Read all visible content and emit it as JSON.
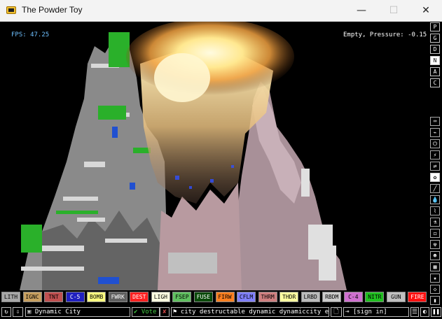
{
  "window": {
    "title": "The Powder Toy",
    "controls": {
      "minimize": "—",
      "maximize": "☐",
      "close": "✕"
    }
  },
  "hud": {
    "fps": "FPS: 47.25",
    "status": "Empty, Pressure: -0.15"
  },
  "right_menu": {
    "top": [
      {
        "label": "P",
        "name": "pause-indicator"
      },
      {
        "label": "G",
        "name": "gravity-indicator"
      },
      {
        "label": "D",
        "name": "decorations-indicator"
      },
      {
        "label": "N",
        "name": "newtonian-indicator",
        "selected": true
      },
      {
        "label": "A",
        "name": "air-indicator"
      },
      {
        "label": "C",
        "name": "colour-indicator"
      }
    ],
    "categories": [
      {
        "icon": "⌨",
        "name": "electronics-icon"
      },
      {
        "icon": "⌁",
        "name": "powered-icon"
      },
      {
        "icon": "⏻",
        "name": "power-icon"
      },
      {
        "icon": "⚡",
        "name": "force-icon"
      },
      {
        "icon": "⇄",
        "name": "sensors-icon"
      },
      {
        "icon": "✿",
        "name": "explosives-icon",
        "selected": true
      },
      {
        "icon": "╱",
        "name": "solids-icon"
      },
      {
        "icon": "💧",
        "name": "liquids-icon"
      },
      {
        "icon": "⌇",
        "name": "gases-icon"
      },
      {
        "icon": "⚗",
        "name": "powders-icon"
      },
      {
        "icon": "◻",
        "name": "special-icon"
      },
      {
        "icon": "☢",
        "name": "radioactive-icon"
      },
      {
        "icon": "☻",
        "name": "life-icon"
      },
      {
        "icon": "▦",
        "name": "tools-icon"
      },
      {
        "icon": "★",
        "name": "favorites-icon"
      },
      {
        "icon": "◇",
        "name": "deco-icon"
      },
      {
        "icon": "▮",
        "name": "search-element-icon"
      }
    ]
  },
  "elements": [
    {
      "label": "LITH",
      "bg": "#a8a8a8",
      "fg": "#000000"
    },
    {
      "label": "IGNC",
      "bg": "#c8a060",
      "fg": "#000000"
    },
    {
      "label": "TNT",
      "bg": "#c05050",
      "fg": "#000000"
    },
    {
      "label": "C-5",
      "bg": "#2020c0",
      "fg": "#ffffff"
    },
    {
      "label": "BOMB",
      "bg": "#ffff80",
      "fg": "#000000"
    },
    {
      "label": "FWRK",
      "bg": "#606060",
      "fg": "#ffffff"
    },
    {
      "label": "DEST",
      "bg": "#ff2020",
      "fg": "#ffffff"
    },
    {
      "label": "LIGH",
      "bg": "#ffffe0",
      "fg": "#000000"
    },
    {
      "label": "FSEP",
      "bg": "#60c060",
      "fg": "#000000"
    },
    {
      "label": "FUSE",
      "bg": "#0a4a0a",
      "fg": "#ffffff"
    },
    {
      "label": "FIRW",
      "bg": "#ff8020",
      "fg": "#000000"
    },
    {
      "label": "CFLM",
      "bg": "#8080ff",
      "fg": "#000000"
    },
    {
      "label": "THRM",
      "bg": "#d08080",
      "fg": "#000000"
    },
    {
      "label": "THDR",
      "bg": "#ffffa0",
      "fg": "#000000"
    },
    {
      "label": "LRBD",
      "bg": "#bbbbbb",
      "fg": "#000000"
    },
    {
      "label": "RBDM",
      "bg": "#cccccc",
      "fg": "#000000"
    },
    {
      "label": "C-4",
      "bg": "#d070d0",
      "fg": "#000000"
    },
    {
      "label": "NITR",
      "bg": "#20c020",
      "fg": "#000000"
    },
    {
      "label": "GUN",
      "bg": "#c0c0c0",
      "fg": "#000000"
    },
    {
      "label": "FIRE",
      "bg": "#ff1010",
      "fg": "#ffffff"
    }
  ],
  "bottom": {
    "open_icon": "↻",
    "save_icon": "⇩",
    "save_name": "Dynamic City",
    "vote_icon": "✔",
    "vote_label": "Vote",
    "vote_down_icon": "✘",
    "tags_icon": "⚑",
    "tags": "city destructable dynamic dynamiccity e...",
    "clear_icon": "🗋",
    "login_icon": "⊸",
    "login": "[sign in]",
    "settings_icon": "☰",
    "renderer_icon": "◐",
    "pause_icon": "❚❚"
  }
}
